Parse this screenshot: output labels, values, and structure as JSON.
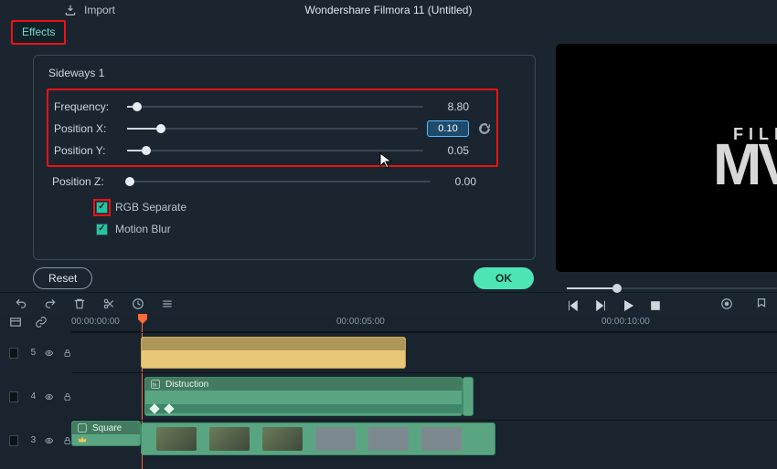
{
  "app_title": "Wondershare Filmora 11 (Untitled)",
  "import_label": "Import",
  "effects_tab": "Effects",
  "panel": {
    "title": "Sideways 1",
    "params": {
      "frequency": {
        "label": "Frequency:",
        "value": "8.80",
        "pct": 2
      },
      "pos_x": {
        "label": "Position X:",
        "value": "0.10",
        "pct": 10
      },
      "pos_y": {
        "label": "Position Y:",
        "value": "0.05",
        "pct": 5
      },
      "pos_z": {
        "label": "Position Z:",
        "value": "0.00",
        "pct": 0
      }
    },
    "rgb_separate": "RGB Separate",
    "motion_blur": "Motion Blur"
  },
  "buttons": {
    "reset": "Reset",
    "ok": "OK"
  },
  "preview_logo": {
    "line1": "FILM",
    "line2": "MV"
  },
  "ruler": {
    "t0": "00:00:00:00",
    "t1": "00:00:05:00",
    "t2": "00:00:10:00"
  },
  "tracks": {
    "t5": "5",
    "t4": "4",
    "t3": "3"
  },
  "clips": {
    "distruction": "Distruction",
    "square": "Square"
  }
}
